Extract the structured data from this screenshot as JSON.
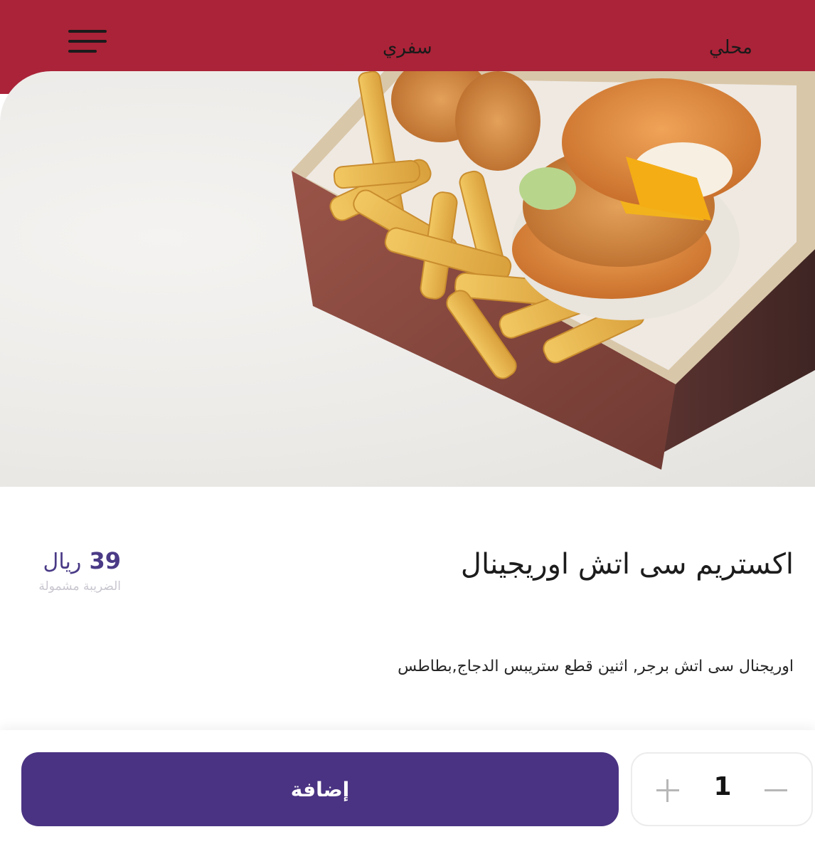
{
  "header": {
    "tab_local": "محلي",
    "tab_takeaway": "سفري",
    "accent_color": "#ab2338"
  },
  "product": {
    "title": "اكستريم سى اتش اوريجينال",
    "description": "اوريجنال سى اتش برجر, اثنين قطع ستريبس الدجاج,بطاطس",
    "price_value": "39",
    "price_currency": "ريال",
    "tax_note": "الضريبة مشمولة",
    "price_color": "#4a3a86"
  },
  "footer": {
    "add_label": "إضافة",
    "quantity": "1",
    "button_color": "#4a3382"
  }
}
